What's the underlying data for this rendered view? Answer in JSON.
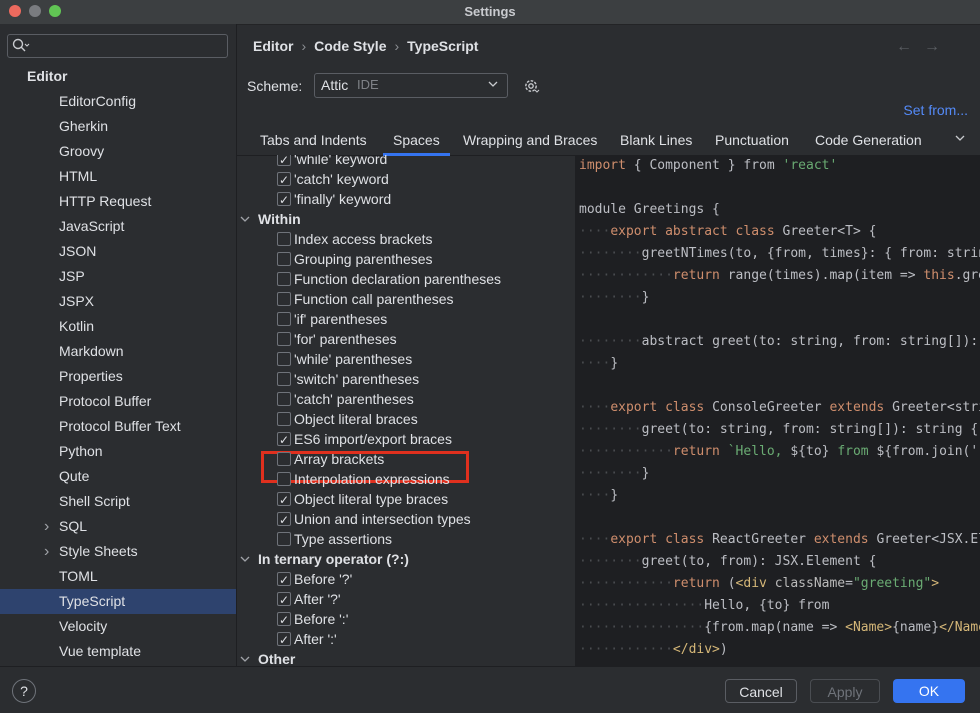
{
  "window": {
    "title": "Settings"
  },
  "sidebar": {
    "search_placeholder": "",
    "items": [
      {
        "label": "Editor",
        "level": 0,
        "bold": true
      },
      {
        "label": "EditorConfig",
        "level": 1
      },
      {
        "label": "Gherkin",
        "level": 1
      },
      {
        "label": "Groovy",
        "level": 1
      },
      {
        "label": "HTML",
        "level": 1
      },
      {
        "label": "HTTP Request",
        "level": 1
      },
      {
        "label": "JavaScript",
        "level": 1
      },
      {
        "label": "JSON",
        "level": 1
      },
      {
        "label": "JSP",
        "level": 1
      },
      {
        "label": "JSPX",
        "level": 1
      },
      {
        "label": "Kotlin",
        "level": 1
      },
      {
        "label": "Markdown",
        "level": 1
      },
      {
        "label": "Properties",
        "level": 1
      },
      {
        "label": "Protocol Buffer",
        "level": 1
      },
      {
        "label": "Protocol Buffer Text",
        "level": 1
      },
      {
        "label": "Python",
        "level": 1
      },
      {
        "label": "Qute",
        "level": 1
      },
      {
        "label": "Shell Script",
        "level": 1
      },
      {
        "label": "SQL",
        "level": 1,
        "expandable": true
      },
      {
        "label": "Style Sheets",
        "level": 1,
        "expandable": true
      },
      {
        "label": "TOML",
        "level": 1
      },
      {
        "label": "TypeScript",
        "level": 1,
        "selected": true
      },
      {
        "label": "Velocity",
        "level": 1
      },
      {
        "label": "Vue template",
        "level": 1
      }
    ]
  },
  "breadcrumb": [
    "Editor",
    "Code Style",
    "TypeScript"
  ],
  "scheme": {
    "label": "Scheme:",
    "name": "Attic",
    "kind": "IDE"
  },
  "set_from": "Set from...",
  "tabs": [
    "Tabs and Indents",
    "Spaces",
    "Wrapping and Braces",
    "Blank Lines",
    "Punctuation",
    "Code Generation"
  ],
  "active_tab": "Spaces",
  "options": [
    {
      "type": "check",
      "label": "'while' keyword",
      "checked": true
    },
    {
      "type": "check",
      "label": "'catch' keyword",
      "checked": true
    },
    {
      "type": "check",
      "label": "'finally' keyword",
      "checked": true
    },
    {
      "type": "group",
      "label": "Within"
    },
    {
      "type": "check",
      "label": "Index access brackets",
      "checked": false
    },
    {
      "type": "check",
      "label": "Grouping parentheses",
      "checked": false
    },
    {
      "type": "check",
      "label": "Function declaration parentheses",
      "checked": false
    },
    {
      "type": "check",
      "label": "Function call parentheses",
      "checked": false
    },
    {
      "type": "check",
      "label": "'if' parentheses",
      "checked": false
    },
    {
      "type": "check",
      "label": "'for' parentheses",
      "checked": false
    },
    {
      "type": "check",
      "label": "'while' parentheses",
      "checked": false
    },
    {
      "type": "check",
      "label": "'switch' parentheses",
      "checked": false
    },
    {
      "type": "check",
      "label": "'catch' parentheses",
      "checked": false
    },
    {
      "type": "check",
      "label": "Object literal braces",
      "checked": false
    },
    {
      "type": "check",
      "label": "ES6 import/export braces",
      "checked": true,
      "highlight": true
    },
    {
      "type": "check",
      "label": "Array brackets",
      "checked": false
    },
    {
      "type": "check",
      "label": "Interpolation expressions",
      "checked": false
    },
    {
      "type": "check",
      "label": "Object literal type braces",
      "checked": true
    },
    {
      "type": "check",
      "label": "Union and intersection types",
      "checked": true
    },
    {
      "type": "check",
      "label": "Type assertions",
      "checked": false
    },
    {
      "type": "group",
      "label": "In ternary operator (?:)"
    },
    {
      "type": "check",
      "label": "Before '?'",
      "checked": true
    },
    {
      "type": "check",
      "label": "After '?'",
      "checked": true
    },
    {
      "type": "check",
      "label": "Before ':'",
      "checked": true
    },
    {
      "type": "check",
      "label": "After ':'",
      "checked": true
    },
    {
      "type": "group",
      "label": "Other"
    }
  ],
  "code_lines": [
    [
      [
        "kw",
        "import"
      ],
      [
        "p",
        " { Component } "
      ],
      [
        "p",
        "from "
      ],
      [
        "str",
        "'react'"
      ]
    ],
    [],
    [
      [
        "p",
        "module Greetings {"
      ]
    ],
    [
      [
        "d",
        "····"
      ],
      [
        "kw",
        "export abstract class "
      ],
      [
        "p",
        "Greeter<T> {"
      ]
    ],
    [
      [
        "d",
        "········"
      ],
      [
        "p",
        "greetNTimes(to, {from, times}: { from: strin"
      ]
    ],
    [
      [
        "d",
        "············"
      ],
      [
        "kw",
        "return "
      ],
      [
        "p",
        "range(times).map(item => "
      ],
      [
        "kw",
        "this"
      ],
      [
        "p",
        ".gre"
      ]
    ],
    [
      [
        "d",
        "········"
      ],
      [
        "p",
        "}"
      ]
    ],
    [],
    [
      [
        "d",
        "········"
      ],
      [
        "p",
        "abstract greet(to: string, from: string[]): "
      ]
    ],
    [
      [
        "d",
        "····"
      ],
      [
        "p",
        "}"
      ]
    ],
    [],
    [
      [
        "d",
        "····"
      ],
      [
        "kw",
        "export class "
      ],
      [
        "p",
        "ConsoleGreeter "
      ],
      [
        "kw",
        "extends "
      ],
      [
        "p",
        "Greeter<stri"
      ]
    ],
    [
      [
        "d",
        "········"
      ],
      [
        "p",
        "greet(to: string, from: string[]): string {"
      ]
    ],
    [
      [
        "d",
        "············"
      ],
      [
        "kw",
        "return "
      ],
      [
        "str",
        "`Hello, "
      ],
      [
        "p",
        "${to} "
      ],
      [
        "str",
        "from "
      ],
      [
        "p",
        "${from.join('"
      ]
    ],
    [
      [
        "d",
        "········"
      ],
      [
        "p",
        "}"
      ]
    ],
    [
      [
        "d",
        "····"
      ],
      [
        "p",
        "}"
      ]
    ],
    [],
    [
      [
        "d",
        "····"
      ],
      [
        "kw",
        "export class "
      ],
      [
        "p",
        "ReactGreeter "
      ],
      [
        "kw",
        "extends "
      ],
      [
        "p",
        "Greeter<JSX.El"
      ]
    ],
    [
      [
        "d",
        "········"
      ],
      [
        "p",
        "greet(to, from): JSX.Element {"
      ]
    ],
    [
      [
        "d",
        "············"
      ],
      [
        "kw",
        "return "
      ],
      [
        "p",
        "("
      ],
      [
        "tag",
        "<div "
      ],
      [
        "attr",
        "className"
      ],
      [
        "p",
        "="
      ],
      [
        "str",
        "\"greeting\""
      ],
      [
        "tag",
        ">"
      ]
    ],
    [
      [
        "d",
        "················"
      ],
      [
        "p",
        "Hello, {to} from"
      ]
    ],
    [
      [
        "d",
        "················"
      ],
      [
        "p",
        "{from.map(name => "
      ],
      [
        "tag",
        "<Name>"
      ],
      [
        "p",
        "{name}"
      ],
      [
        "tag",
        "</Name"
      ]
    ],
    [
      [
        "d",
        "············"
      ],
      [
        "tag",
        "</div>"
      ],
      [
        "p",
        ")"
      ]
    ]
  ],
  "footer": {
    "help": "?",
    "cancel": "Cancel",
    "apply": "Apply",
    "ok": "OK"
  },
  "colors": {
    "accent": "#3574f0",
    "selection": "#2e436e",
    "highlight_box": "#e0301e",
    "link": "#548af7"
  }
}
